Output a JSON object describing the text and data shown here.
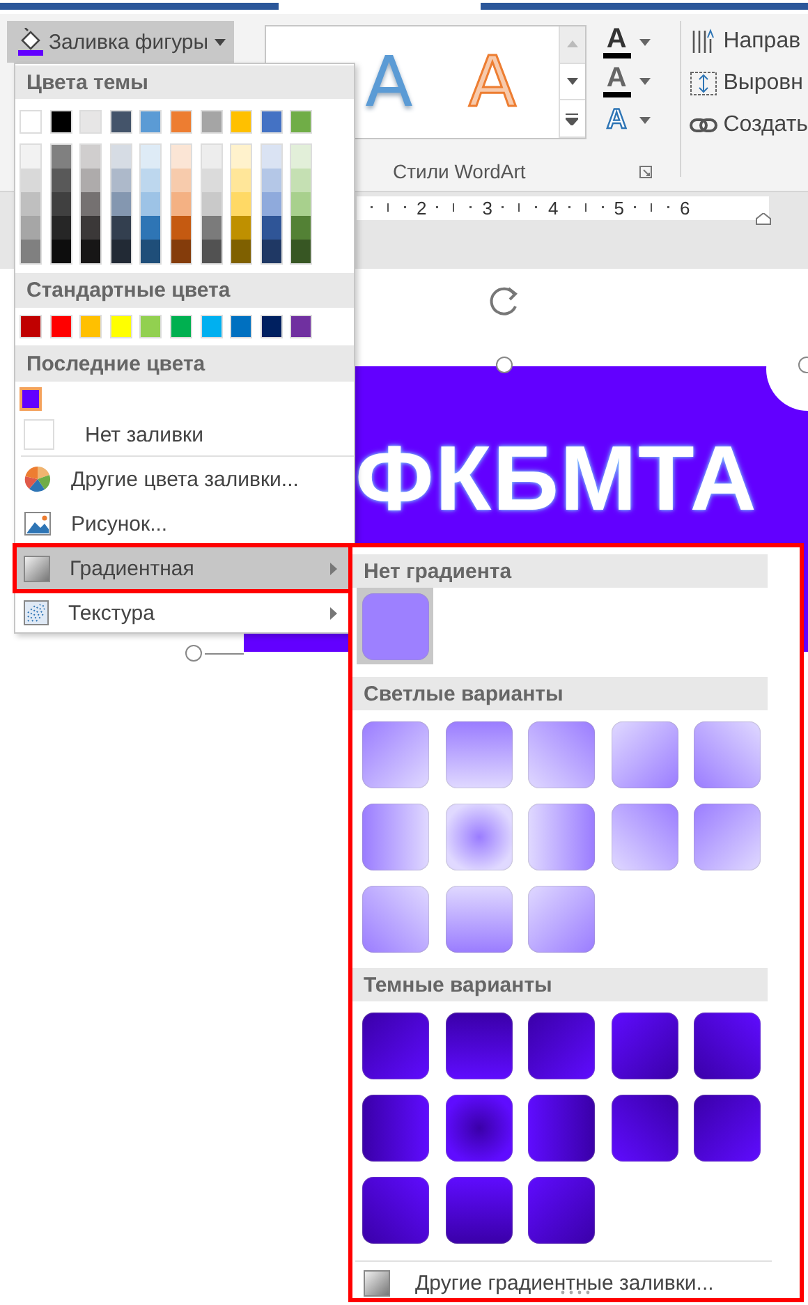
{
  "ribbon": {
    "fill_button": {
      "label": "Заливка фигуры",
      "pressed": true,
      "color": "#6200ff"
    },
    "wordart_gallery": {
      "items": [
        {
          "text": "A",
          "kind": "blue"
        },
        {
          "text": "A",
          "kind": "orange"
        }
      ],
      "label": "Стили WordArt"
    },
    "text_effects": [
      {
        "glyph": "A",
        "kind": "fill"
      },
      {
        "glyph": "A",
        "kind": "outline"
      },
      {
        "glyph": "A",
        "kind": "effects"
      }
    ],
    "arrange": [
      {
        "label": "Направ",
        "kind": "direction"
      },
      {
        "label": "Выровн",
        "kind": "align"
      },
      {
        "label": "Создать",
        "kind": "link"
      }
    ]
  },
  "ruler": [
    "2",
    "3",
    "4",
    "5",
    "6"
  ],
  "shape": {
    "text": "ФКБМТА"
  },
  "fill_menu": {
    "theme_colors": {
      "title": "Цвета темы",
      "columns": [
        {
          "color": "#ffffff",
          "shades": [
            {
              "color": "#f2f2f2"
            },
            {
              "color": "#d9d9d9"
            },
            {
              "color": "#bfbfbf"
            },
            {
              "color": "#a6a6a6"
            },
            {
              "color": "#808080"
            }
          ]
        },
        {
          "color": "#000000",
          "shades": [
            {
              "color": "#808080"
            },
            {
              "color": "#595959"
            },
            {
              "color": "#404040"
            },
            {
              "color": "#262626"
            },
            {
              "color": "#0d0d0d"
            }
          ]
        },
        {
          "color": "#e7e6e6",
          "shades": [
            {
              "color": "#d0cece"
            },
            {
              "color": "#aeabab"
            },
            {
              "color": "#757171"
            },
            {
              "color": "#3b3838"
            },
            {
              "color": "#171616"
            }
          ]
        },
        {
          "color": "#44546a",
          "shades": [
            {
              "color": "#d6dce4"
            },
            {
              "color": "#adb9ca"
            },
            {
              "color": "#8497b0"
            },
            {
              "color": "#333f4f"
            },
            {
              "color": "#222a35"
            }
          ]
        },
        {
          "color": "#5b9bd5",
          "shades": [
            {
              "color": "#deebf6"
            },
            {
              "color": "#bdd7ee"
            },
            {
              "color": "#9dc3e6"
            },
            {
              "color": "#2e75b5"
            },
            {
              "color": "#1f4e79"
            }
          ]
        },
        {
          "color": "#ed7d31",
          "shades": [
            {
              "color": "#fbe5d5"
            },
            {
              "color": "#f7cbac"
            },
            {
              "color": "#f4b183"
            },
            {
              "color": "#c55a11"
            },
            {
              "color": "#843c0b"
            }
          ]
        },
        {
          "color": "#a5a5a5",
          "shades": [
            {
              "color": "#ededed"
            },
            {
              "color": "#dbdbdb"
            },
            {
              "color": "#c9c9c9"
            },
            {
              "color": "#7b7b7b"
            },
            {
              "color": "#525252"
            }
          ]
        },
        {
          "color": "#ffc000",
          "shades": [
            {
              "color": "#fff2cc"
            },
            {
              "color": "#ffe699"
            },
            {
              "color": "#ffd965"
            },
            {
              "color": "#bf9000"
            },
            {
              "color": "#7f6000"
            }
          ]
        },
        {
          "color": "#4472c4",
          "shades": [
            {
              "color": "#dae3f3"
            },
            {
              "color": "#b4c7e7"
            },
            {
              "color": "#8faadc"
            },
            {
              "color": "#2f5597"
            },
            {
              "color": "#1f3864"
            }
          ]
        },
        {
          "color": "#70ad47",
          "shades": [
            {
              "color": "#e2efd9"
            },
            {
              "color": "#c5e0b3"
            },
            {
              "color": "#a8d08d"
            },
            {
              "color": "#538135"
            },
            {
              "color": "#375623"
            }
          ]
        }
      ]
    },
    "standard_colors": {
      "title": "Стандартные цвета",
      "colors": [
        {
          "color": "#c00000"
        },
        {
          "color": "#ff0000"
        },
        {
          "color": "#ffc000"
        },
        {
          "color": "#ffff00"
        },
        {
          "color": "#92d050"
        },
        {
          "color": "#00b050"
        },
        {
          "color": "#00b0f0"
        },
        {
          "color": "#0070c0"
        },
        {
          "color": "#002060"
        },
        {
          "color": "#7030a0"
        }
      ]
    },
    "recent_colors": {
      "title": "Последние цвета",
      "colors": [
        {
          "color": "#6200ff",
          "selected": true
        }
      ]
    },
    "no_fill": "Нет заливки",
    "items": [
      {
        "label": "Другие цвета заливки...",
        "kind": "palette",
        "selected": false,
        "submenu": false,
        "annotated": false
      },
      {
        "label": "Рисунок...",
        "kind": "picture",
        "selected": false,
        "submenu": false,
        "annotated": false
      },
      {
        "label": "Градиентная",
        "kind": "gradient",
        "selected": true,
        "submenu": true,
        "annotated": true
      },
      {
        "label": "Текстура",
        "kind": "texture",
        "selected": false,
        "submenu": true,
        "annotated": false
      }
    ]
  },
  "gradient_menu": {
    "annotated": true,
    "sections": [
      {
        "title": "Нет градиента",
        "kind": "solid",
        "swatches": [
          {
            "kind": "none",
            "selected": true
          }
        ]
      },
      {
        "title": "Светлые варианты",
        "kind": "light",
        "swatches": [
          {
            "kind": "tl",
            "selected": false
          },
          {
            "kind": "t",
            "selected": false
          },
          {
            "kind": "tr",
            "selected": false
          },
          {
            "kind": "br",
            "selected": false
          },
          {
            "kind": "bl",
            "selected": false
          },
          {
            "kind": "l",
            "selected": false
          },
          {
            "kind": "c",
            "selected": false
          },
          {
            "kind": "r",
            "selected": false
          },
          {
            "kind": "tr",
            "selected": false
          },
          {
            "kind": "tl",
            "selected": false
          },
          {
            "kind": "bl",
            "selected": false
          },
          {
            "kind": "b",
            "selected": false
          },
          {
            "kind": "br",
            "selected": false
          }
        ]
      },
      {
        "title": "Темные варианты",
        "kind": "dark",
        "swatches": [
          {
            "kind": "tl",
            "selected": false
          },
          {
            "kind": "t",
            "selected": false
          },
          {
            "kind": "tl",
            "selected": false
          },
          {
            "kind": "br",
            "selected": false
          },
          {
            "kind": "bl",
            "selected": false
          },
          {
            "kind": "l",
            "selected": false
          },
          {
            "kind": "c",
            "selected": false
          },
          {
            "kind": "r",
            "selected": false
          },
          {
            "kind": "tr",
            "selected": false
          },
          {
            "kind": "tl",
            "selected": false
          },
          {
            "kind": "bl",
            "selected": false
          },
          {
            "kind": "b",
            "selected": false
          },
          {
            "kind": "br",
            "selected": false
          }
        ]
      }
    ],
    "more": "Другие градиентные заливки..."
  }
}
